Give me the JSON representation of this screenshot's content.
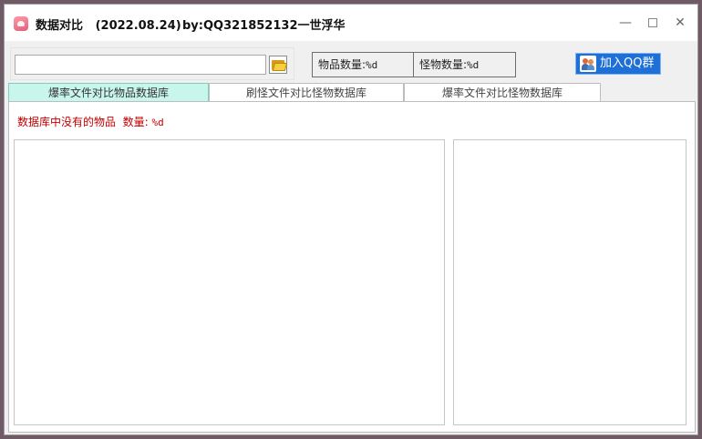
{
  "window": {
    "title": "数据对比   (2022.08.24)",
    "author": "by:QQ321852132一世浮华",
    "minimize_glyph": "—",
    "close_glyph": "✕"
  },
  "path": {
    "value": "",
    "browse_icon": "folder-open-icon"
  },
  "counts": {
    "items_label": "物品数量:",
    "items_value": "%d",
    "monsters_label": "怪物数量:",
    "monsters_value": "%d"
  },
  "join_button": {
    "label": "加入QQ群",
    "icon": "people-icon"
  },
  "tabs": [
    {
      "label": "爆率文件对比物品数据库",
      "active": true
    },
    {
      "label": "刷怪文件对比怪物数据库",
      "active": false
    },
    {
      "label": "爆率文件对比怪物数据库",
      "active": false
    }
  ],
  "panel": {
    "missing_label": "数据库中没有的物品  数量:",
    "missing_value": "%d"
  },
  "colors": {
    "active_tab": "#c8f5ec",
    "alert_text": "#c40000",
    "join_button": "#1e6fd6"
  }
}
